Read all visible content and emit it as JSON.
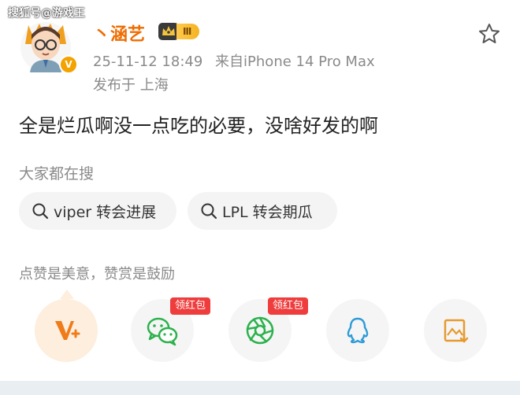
{
  "watermark": "搜狐号@游戏王",
  "post": {
    "username": "丶涵艺",
    "vip_level": "Ⅲ",
    "time": "25-11-12 18:49",
    "source": "来自iPhone 14 Pro Max",
    "location": "发布于 上海",
    "text": "全是烂瓜啊没一点吃的必要，没啥好发的啊"
  },
  "search": {
    "title": "大家都在搜",
    "chips": [
      "viper 转会进展",
      "LPL 转会期瓜"
    ]
  },
  "reward": {
    "prompt": "点赞是美意，赞赏是鼓励",
    "redpack_label": "领红包",
    "actions": [
      {
        "icon": "v-reward-icon"
      },
      {
        "icon": "wechat-icon",
        "color": "#2bb24c"
      },
      {
        "icon": "moments-icon",
        "color": "#2bb24c"
      },
      {
        "icon": "qq-icon",
        "color": "#2e9bd7"
      },
      {
        "icon": "save-image-icon",
        "color": "#e69a2e"
      }
    ]
  },
  "colors": {
    "username": "#ef6c00",
    "accent": "#ef3d3d",
    "vip": "#f5b323"
  }
}
